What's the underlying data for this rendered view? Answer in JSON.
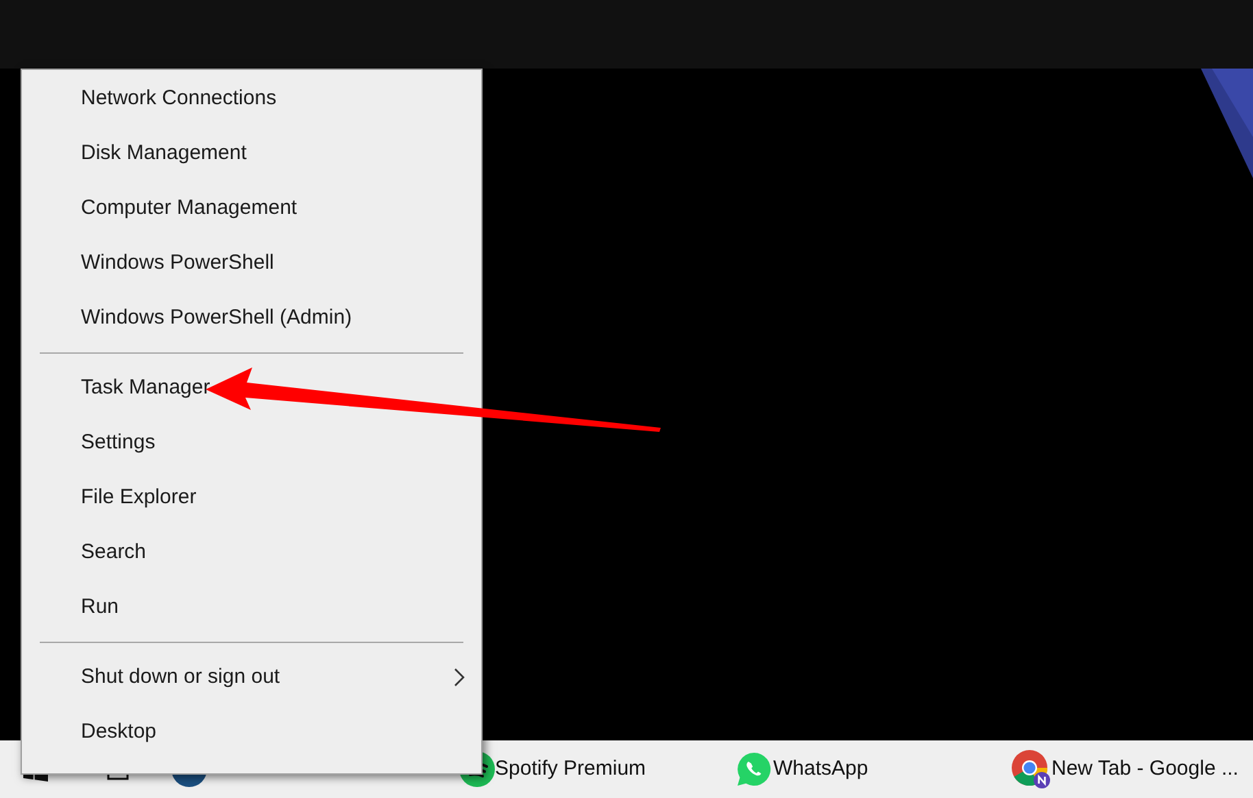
{
  "context_menu": {
    "groups": [
      {
        "items": [
          {
            "label": "Network Connections",
            "kind": "plain"
          },
          {
            "label": "Disk Management",
            "kind": "plain"
          },
          {
            "label": "Computer Management",
            "kind": "plain"
          },
          {
            "label": "Windows PowerShell",
            "kind": "plain"
          },
          {
            "label": "Windows PowerShell (Admin)",
            "kind": "plain"
          }
        ]
      },
      {
        "items": [
          {
            "label": "Task Manager",
            "kind": "plain"
          },
          {
            "label": "Settings",
            "kind": "plain"
          },
          {
            "label": "File Explorer",
            "kind": "plain"
          },
          {
            "label": "Search",
            "kind": "plain"
          },
          {
            "label": "Run",
            "kind": "plain"
          }
        ]
      },
      {
        "items": [
          {
            "label": "Shut down or sign out",
            "kind": "submenu"
          },
          {
            "label": "Desktop",
            "kind": "plain"
          }
        ]
      }
    ]
  },
  "taskbar": {
    "apps": [
      {
        "label": "Spotify Premium",
        "kind": "spotify"
      },
      {
        "label": "WhatsApp",
        "kind": "whatsapp"
      },
      {
        "label": "New Tab - Google ...",
        "kind": "chrome"
      }
    ]
  }
}
